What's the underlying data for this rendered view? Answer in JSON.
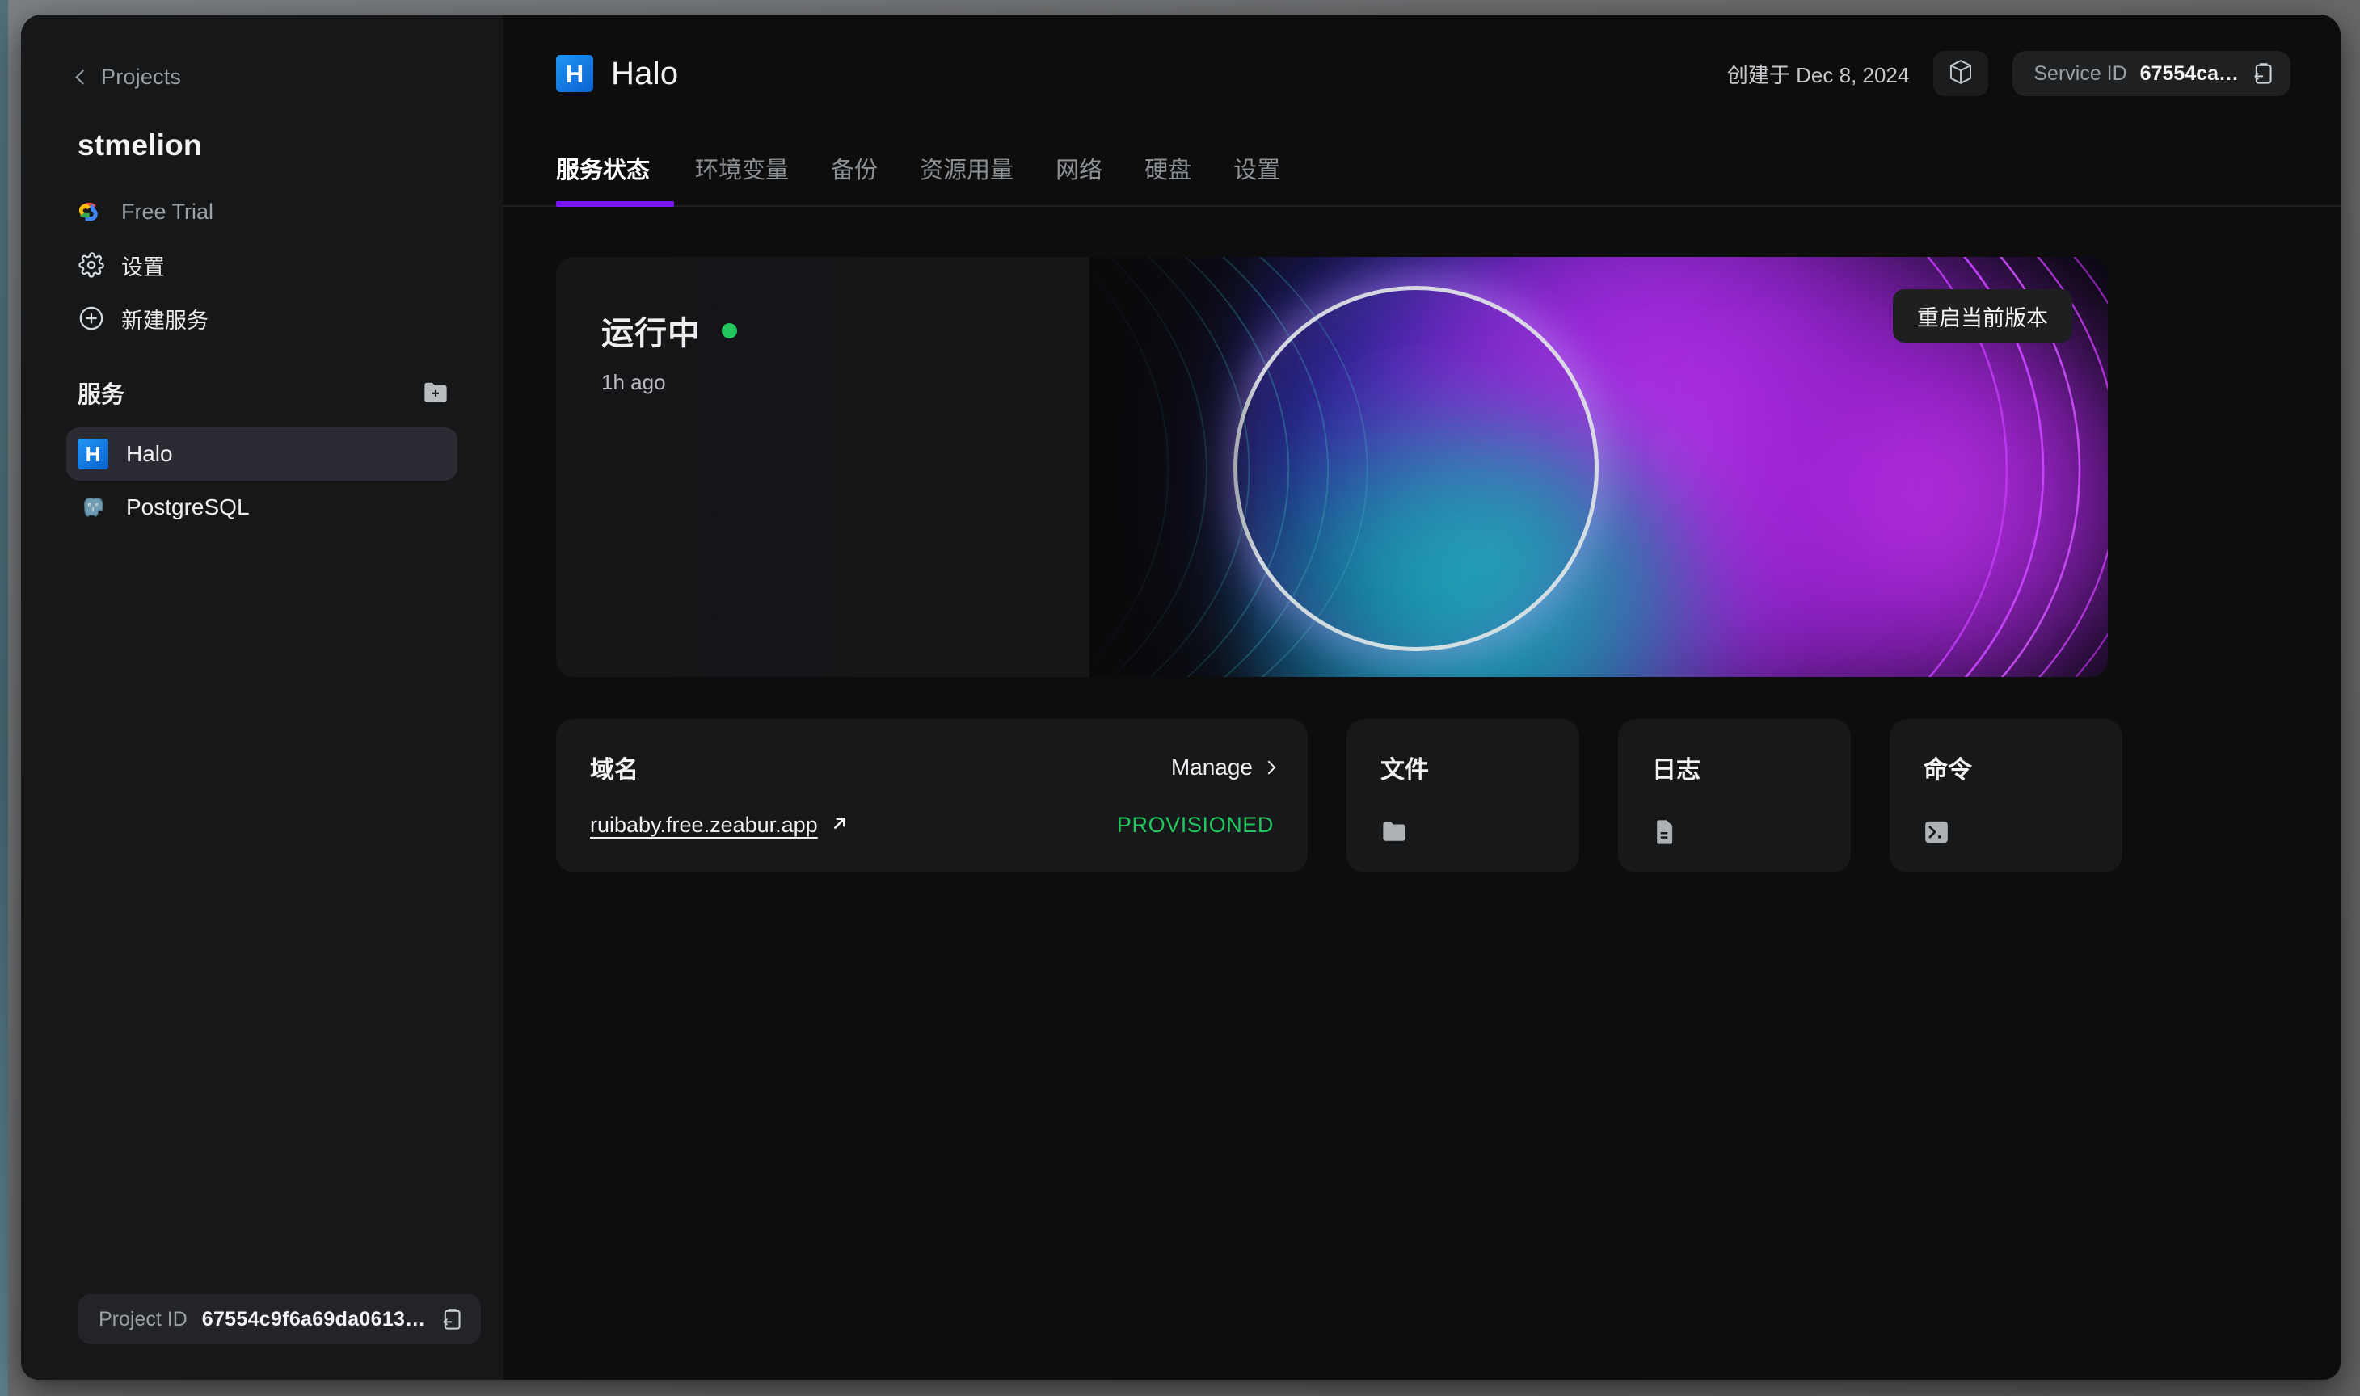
{
  "sidebar": {
    "back_label": "Projects",
    "org_name": "stmelion",
    "nav": [
      {
        "label": "Free Trial",
        "icon": "google-cloud-icon"
      },
      {
        "label": "设置",
        "icon": "gear-icon"
      },
      {
        "label": "新建服务",
        "icon": "plus-circle-icon"
      }
    ],
    "services_section": {
      "title": "服务",
      "add_icon": "folder-plus-icon",
      "items": [
        {
          "label": "Halo",
          "icon": "halo-logo",
          "badge": "H",
          "active": true
        },
        {
          "label": "PostgreSQL",
          "icon": "postgresql-logo",
          "active": false
        }
      ]
    },
    "project_id": {
      "label": "Project ID",
      "value": "67554c9f6a69da0613…",
      "copy_icon": "copy-icon"
    }
  },
  "header": {
    "service_badge": "H",
    "service_title": "Halo",
    "created_at": "创建于 Dec 8, 2024",
    "cube_icon": "cube-icon",
    "service_id": {
      "label": "Service ID",
      "value": "67554ca…",
      "copy_icon": "copy-icon"
    }
  },
  "tabs": [
    {
      "label": "服务状态",
      "active": true
    },
    {
      "label": "环境变量",
      "active": false
    },
    {
      "label": "备份",
      "active": false
    },
    {
      "label": "资源用量",
      "active": false
    },
    {
      "label": "网络",
      "active": false
    },
    {
      "label": "硬盘",
      "active": false
    },
    {
      "label": "设置",
      "active": false
    }
  ],
  "hero": {
    "status": "运行中",
    "status_color": "#22c55e",
    "updated": "1h ago",
    "restart_label": "重启当前版本"
  },
  "cards": {
    "domain": {
      "title": "域名",
      "manage_label": "Manage",
      "url": "ruibaby.free.zeabur.app",
      "external_icon": "external-link-icon",
      "status": "PROVISIONED",
      "status_color": "#22c55e"
    },
    "files": {
      "title": "文件",
      "icon": "folder-icon"
    },
    "logs": {
      "title": "日志",
      "icon": "document-icon"
    },
    "commands": {
      "title": "命令",
      "icon": "terminal-icon"
    }
  },
  "theme": {
    "accent": "#7b16ff",
    "sidebar_bg": "#161718",
    "main_bg": "#0d0d0e",
    "card_bg": "#17181a",
    "brand_blue": "#1478e0"
  }
}
